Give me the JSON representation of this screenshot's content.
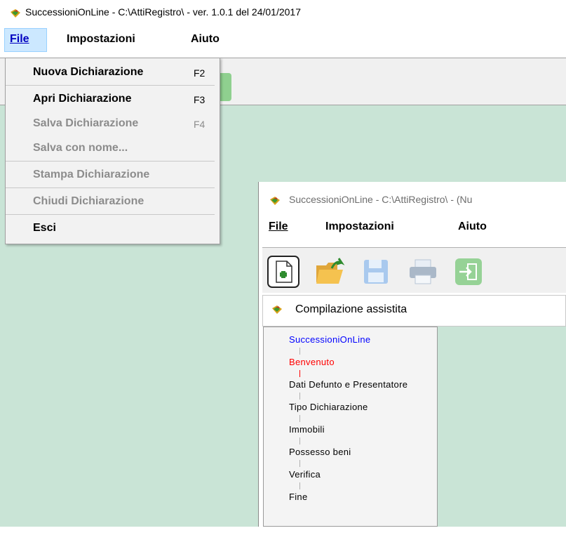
{
  "window": {
    "title": "SuccessioniOnLine - C:\\AttiRegistro\\  -  ver. 1.0.1 del 24/01/2017"
  },
  "menubar": {
    "file": "File",
    "impostazioni": "Impostazioni",
    "aiuto": "Aiuto"
  },
  "file_menu": {
    "items": [
      {
        "label": "Nuova Dichiarazione",
        "shortcut": "F2"
      },
      {
        "label": "Apri Dichiarazione",
        "shortcut": "F3"
      },
      {
        "label": "Salva Dichiarazione",
        "shortcut": "F4"
      },
      {
        "label": "Salva con nome...",
        "shortcut": ""
      },
      {
        "label": "Stampa Dichiarazione",
        "shortcut": ""
      },
      {
        "label": "Chiudi Dichiarazione",
        "shortcut": ""
      },
      {
        "label": "Esci",
        "shortcut": ""
      }
    ]
  },
  "inner_window": {
    "title": "SuccessioniOnLine - C:\\AttiRegistro\\ - (Nu",
    "menu": {
      "file": "File",
      "impostazioni": "Impostazioni",
      "aiuto": "Aiuto"
    },
    "guide_title": "Compilazione assistita",
    "tree": [
      {
        "label": "SuccessioniOnLine",
        "color": "#0000ff"
      },
      {
        "label": "Benvenuto",
        "color": "#ff0000"
      },
      {
        "label": "Dati Defunto e Presentatore",
        "color": "#000000"
      },
      {
        "label": "Tipo Dichiarazione",
        "color": "#000000"
      },
      {
        "label": "Immobili",
        "color": "#000000"
      },
      {
        "label": "Possesso beni",
        "color": "#000000"
      },
      {
        "label": "Verifica",
        "color": "#000000"
      },
      {
        "label": "Fine",
        "color": "#000000"
      }
    ]
  },
  "icons": {
    "app": "app-icon",
    "new": "new-document-icon",
    "open": "open-folder-icon",
    "save": "save-disk-icon",
    "print": "print-icon",
    "exit": "exit-icon"
  },
  "colors": {
    "workspace": "#c9e4d6",
    "menu_highlight": "#cce8ff",
    "tree_active": "#ff0000",
    "tree_root": "#0000ff"
  }
}
